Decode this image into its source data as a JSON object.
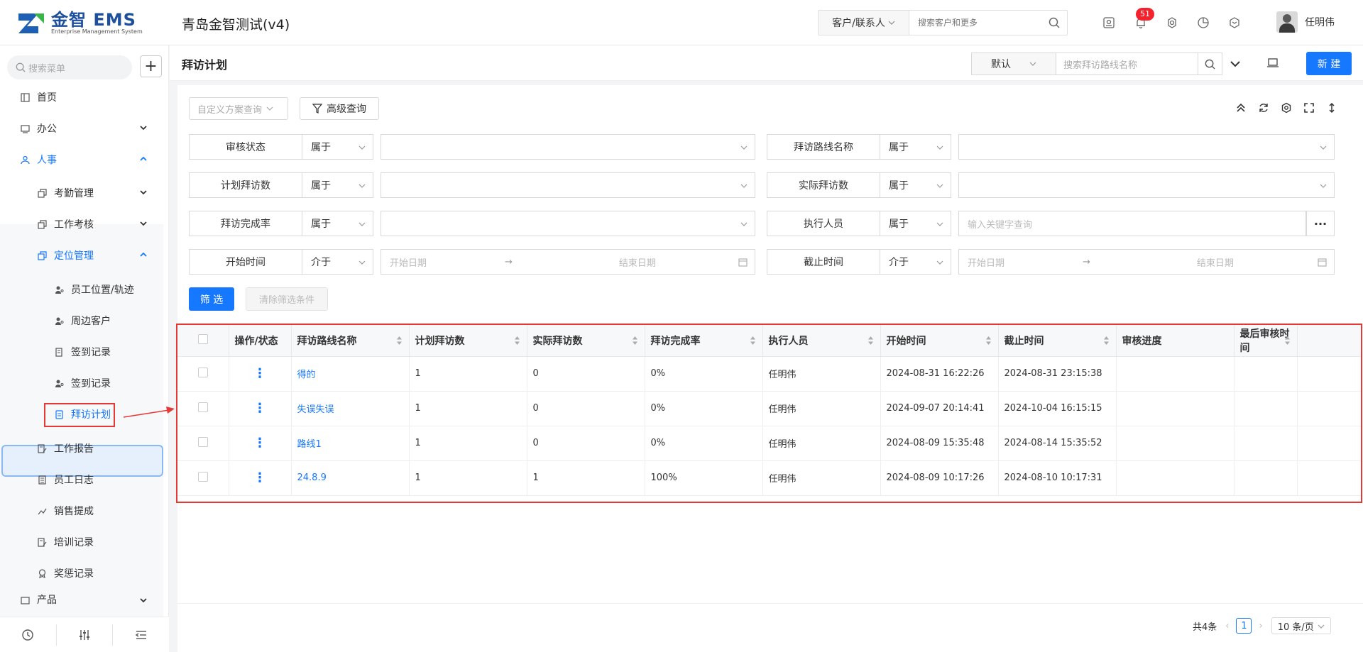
{
  "app": {
    "logo_text": "金智 EMS",
    "logo_sub": "Enterprise Management System",
    "company": "青岛金智测试(v4)",
    "search_scope": "客户/联系人",
    "search_placeholder": "搜索客户和更多",
    "notification_count": "51",
    "username": "任明伟"
  },
  "sidebar": {
    "search_placeholder": "搜索菜单",
    "items": [
      {
        "label": "首页"
      },
      {
        "label": "办公"
      },
      {
        "label": "人事"
      },
      {
        "label": "考勤管理"
      },
      {
        "label": "工作考核"
      },
      {
        "label": "定位管理"
      },
      {
        "label": "员工位置/轨迹"
      },
      {
        "label": "周边客户"
      },
      {
        "label": "签到记录"
      },
      {
        "label": "签到记录"
      },
      {
        "label": "拜访计划"
      },
      {
        "label": "工作报告"
      },
      {
        "label": "员工日志"
      },
      {
        "label": "销售提成"
      },
      {
        "label": "培训记录"
      },
      {
        "label": "奖惩记录"
      },
      {
        "label": "产品"
      }
    ]
  },
  "page": {
    "title": "拜访计划",
    "view_select": "默认",
    "search_placeholder": "搜索拜访路线名称",
    "new_button": "新 建",
    "custom_query_placeholder": "自定义方案查询",
    "advanced_query": "高级查询"
  },
  "filters": {
    "rows": [
      {
        "left_label": "审核状态",
        "left_op": "属于",
        "right_label": "拜访路线名称",
        "right_op": "属于"
      },
      {
        "left_label": "计划拜访数",
        "left_op": "属于",
        "right_label": "实际拜访数",
        "right_op": "属于"
      },
      {
        "left_label": "拜访完成率",
        "left_op": "属于",
        "right_label": "执行人员",
        "right_op": "属于",
        "right_placeholder": "输入关键字查询"
      },
      {
        "left_label": "开始时间",
        "left_op": "介于",
        "right_label": "截止时间",
        "right_op": "介于"
      }
    ],
    "start_date_placeholder": "开始日期",
    "end_date_placeholder": "结束日期",
    "arrow": "→",
    "filter_button": "筛 选",
    "clear_button": "清除筛选条件"
  },
  "table": {
    "columns": [
      "操作/状态",
      "拜访路线名称",
      "计划拜访数",
      "实际拜访数",
      "拜访完成率",
      "执行人员",
      "开始时间",
      "截止时间",
      "审核进度",
      "最后审核时间"
    ],
    "rows": [
      {
        "name": "得的",
        "planned": "1",
        "actual": "0",
        "rate": "0%",
        "executor": "任明伟",
        "start": "2024-08-31 16:22:26",
        "end": "2024-08-31 23:15:38",
        "progress": "",
        "last_review": ""
      },
      {
        "name": "失误失误",
        "planned": "1",
        "actual": "0",
        "rate": "0%",
        "executor": "任明伟",
        "start": "2024-09-07 20:14:41",
        "end": "2024-10-04 16:15:15",
        "progress": "",
        "last_review": ""
      },
      {
        "name": "路线1",
        "planned": "1",
        "actual": "0",
        "rate": "0%",
        "executor": "任明伟",
        "start": "2024-08-09 15:35:48",
        "end": "2024-08-14 15:35:52",
        "progress": "",
        "last_review": ""
      },
      {
        "name": "24.8.9",
        "planned": "1",
        "actual": "1",
        "rate": "100%",
        "executor": "任明伟",
        "start": "2024-08-09 10:17:26",
        "end": "2024-08-10 10:17:31",
        "progress": "",
        "last_review": ""
      }
    ]
  },
  "pagination": {
    "total": "共4条",
    "current": "1",
    "page_size": "10 条/页"
  },
  "colors": {
    "primary": "#1677ff",
    "highlight_border": "#e53935",
    "badge": "#f5222d"
  }
}
